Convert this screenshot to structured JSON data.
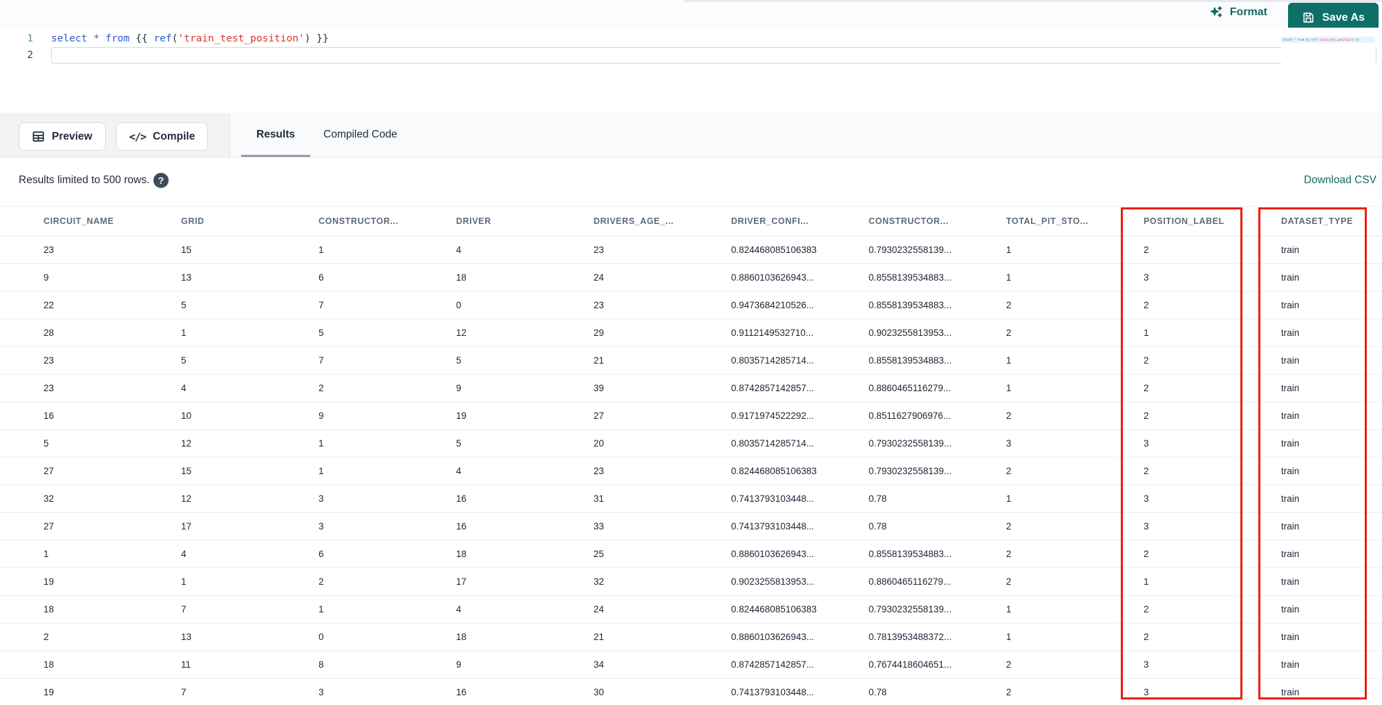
{
  "topbar": {
    "format_label": "Format",
    "save_as_label": "Save As"
  },
  "editor": {
    "line_numbers": [
      "1",
      "2"
    ],
    "sql_text": "select * from {{ ref('train_test_position') }}",
    "tokens": [
      {
        "text": "select",
        "type": "kw"
      },
      {
        "text": " ",
        "type": "pl"
      },
      {
        "text": "*",
        "type": "op"
      },
      {
        "text": " ",
        "type": "pl"
      },
      {
        "text": "from",
        "type": "kw"
      },
      {
        "text": " {{ ",
        "type": "pl"
      },
      {
        "text": "ref",
        "type": "kw"
      },
      {
        "text": "(",
        "type": "pl"
      },
      {
        "text": "'train_test_position'",
        "type": "str"
      },
      {
        "text": ") }}",
        "type": "pl"
      }
    ]
  },
  "actions": {
    "preview_label": "Preview",
    "compile_label": "Compile",
    "compile_icon": "</>"
  },
  "tabs": [
    {
      "label": "Results",
      "active": true
    },
    {
      "label": "Compiled Code",
      "active": false
    }
  ],
  "results_bar": {
    "limit_text": "Results limited to 500 rows.",
    "help_icon": "?",
    "download_label": "Download CSV"
  },
  "table": {
    "columns": [
      "CIRCUIT_NAME",
      "GRID",
      "CONSTRUCTOR...",
      "DRIVER",
      "DRIVERS_AGE_...",
      "DRIVER_CONFI...",
      "CONSTRUCTOR...",
      "TOTAL_PIT_STO...",
      "POSITION_LABEL",
      "DATASET_TYPE"
    ],
    "annotated_columns": [
      "POSITION_LABEL",
      "DATASET_TYPE"
    ],
    "rows": [
      [
        "23",
        "15",
        "1",
        "4",
        "23",
        "0.824468085106383",
        "0.7930232558139...",
        "1",
        "2",
        "train"
      ],
      [
        "9",
        "13",
        "6",
        "18",
        "24",
        "0.8860103626943...",
        "0.8558139534883...",
        "1",
        "3",
        "train"
      ],
      [
        "22",
        "5",
        "7",
        "0",
        "23",
        "0.9473684210526...",
        "0.8558139534883...",
        "2",
        "2",
        "train"
      ],
      [
        "28",
        "1",
        "5",
        "12",
        "29",
        "0.9112149532710...",
        "0.9023255813953...",
        "2",
        "1",
        "train"
      ],
      [
        "23",
        "5",
        "7",
        "5",
        "21",
        "0.8035714285714...",
        "0.8558139534883...",
        "1",
        "2",
        "train"
      ],
      [
        "23",
        "4",
        "2",
        "9",
        "39",
        "0.8742857142857...",
        "0.8860465116279...",
        "1",
        "2",
        "train"
      ],
      [
        "16",
        "10",
        "9",
        "19",
        "27",
        "0.9171974522292...",
        "0.8511627906976...",
        "2",
        "2",
        "train"
      ],
      [
        "5",
        "12",
        "1",
        "5",
        "20",
        "0.8035714285714...",
        "0.7930232558139...",
        "3",
        "3",
        "train"
      ],
      [
        "27",
        "15",
        "1",
        "4",
        "23",
        "0.824468085106383",
        "0.7930232558139...",
        "2",
        "2",
        "train"
      ],
      [
        "32",
        "12",
        "3",
        "16",
        "31",
        "0.7413793103448...",
        "0.78",
        "1",
        "3",
        "train"
      ],
      [
        "27",
        "17",
        "3",
        "16",
        "33",
        "0.7413793103448...",
        "0.78",
        "2",
        "3",
        "train"
      ],
      [
        "1",
        "4",
        "6",
        "18",
        "25",
        "0.8860103626943...",
        "0.8558139534883...",
        "2",
        "2",
        "train"
      ],
      [
        "19",
        "1",
        "2",
        "17",
        "32",
        "0.9023255813953...",
        "0.8860465116279...",
        "2",
        "1",
        "train"
      ],
      [
        "18",
        "7",
        "1",
        "4",
        "24",
        "0.824468085106383",
        "0.7930232558139...",
        "1",
        "2",
        "train"
      ],
      [
        "2",
        "13",
        "0",
        "18",
        "21",
        "0.8860103626943...",
        "0.7813953488372...",
        "1",
        "2",
        "train"
      ],
      [
        "18",
        "11",
        "8",
        "9",
        "34",
        "0.8742857142857...",
        "0.7674418604651...",
        "2",
        "3",
        "train"
      ],
      [
        "19",
        "7",
        "3",
        "16",
        "30",
        "0.7413793103448...",
        "0.78",
        "2",
        "3",
        "train"
      ]
    ]
  },
  "colors": {
    "accent_teal": "#0e6f66",
    "link_teal": "#17695f",
    "annotation_red": "#ee1d0e",
    "keyword_blue": "#2c5dcd",
    "string_red": "#d6382c",
    "header_text": "#5c6a7d"
  }
}
